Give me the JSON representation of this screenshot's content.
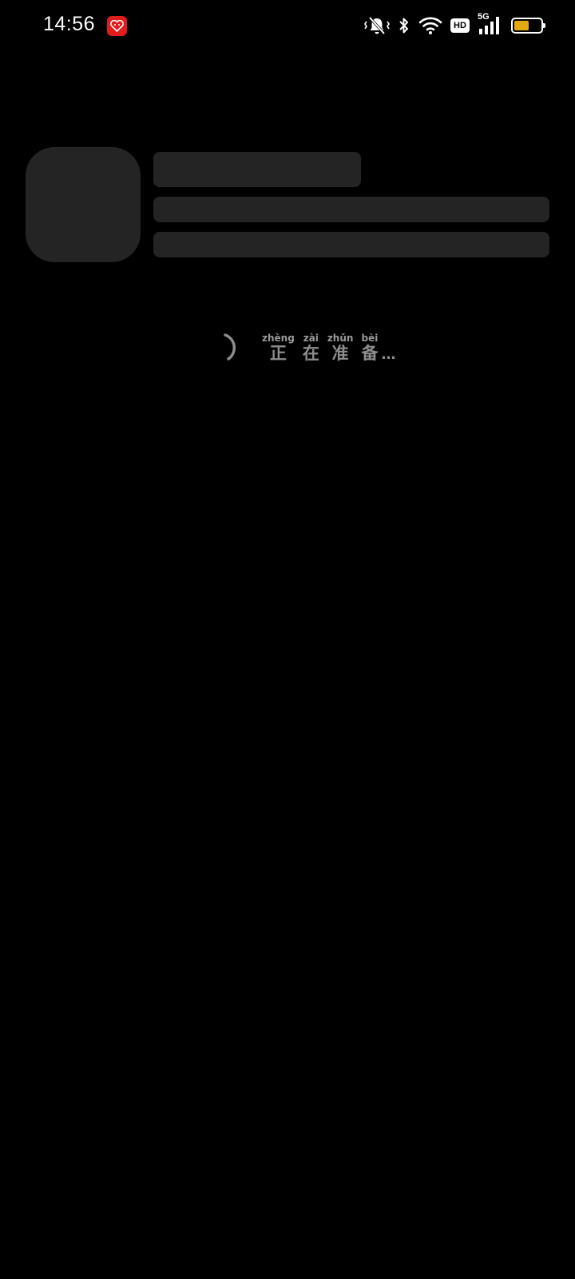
{
  "status_bar": {
    "time": "14:56",
    "notification_app_icon": "red-app-icon",
    "icons": [
      "mute-vibrate-icon",
      "bluetooth-icon",
      "wifi-icon",
      "hd-icon",
      "5g-signal-icon",
      "battery-icon"
    ],
    "hd_label": "HD",
    "network_label": "5G",
    "battery_level": 0.55,
    "battery_color": "#e3a812"
  },
  "loading": {
    "characters": [
      {
        "char": "正",
        "pinyin": "zhèng"
      },
      {
        "char": "在",
        "pinyin": "zài"
      },
      {
        "char": "准",
        "pinyin": "zhǔn"
      },
      {
        "char": "备",
        "pinyin": "bèi"
      }
    ],
    "ellipsis": "…",
    "spinner_color": "#8d8d8d"
  },
  "skeleton_color": "#242424"
}
